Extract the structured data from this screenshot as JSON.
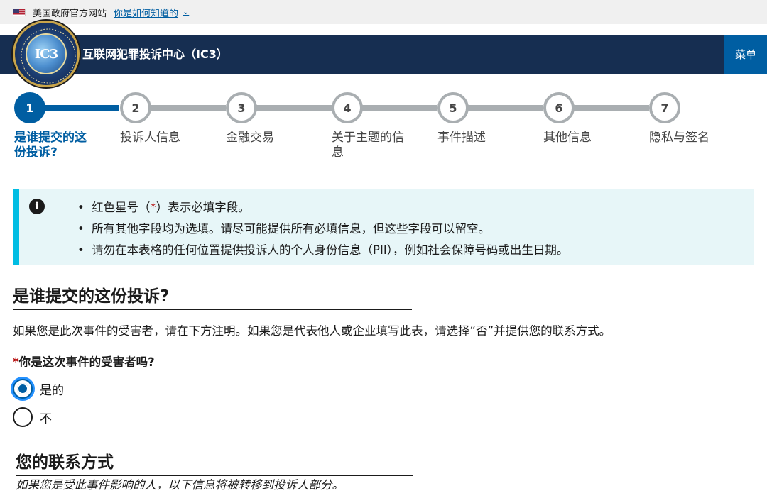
{
  "gov_banner": {
    "text": "美国政府官方网站",
    "link": "你是如何知道的"
  },
  "header": {
    "title": "互联网犯罪投诉中心（IC3）",
    "menu": "菜单",
    "seal_text": "IC3"
  },
  "stepper": {
    "current": 1,
    "steps": [
      {
        "number": "1",
        "label": "是谁提交的这份投诉?"
      },
      {
        "number": "2",
        "label": "投诉人信息"
      },
      {
        "number": "3",
        "label": "金融交易"
      },
      {
        "number": "4",
        "label": "关于主题的信息"
      },
      {
        "number": "5",
        "label": "事件描述"
      },
      {
        "number": "6",
        "label": "其他信息"
      },
      {
        "number": "7",
        "label": "隐私与签名"
      }
    ]
  },
  "alert": {
    "items": [
      {
        "before": "红色星号（",
        "star": "*",
        "after": "）表示必填字段。"
      },
      {
        "text": "所有其他字段均为选填。请尽可能提供所有必填信息，但这些字段可以留空。"
      },
      {
        "text": "请勿在本表格的任何位置提供投诉人的个人身份信息（PII），例如社会保障号码或出生日期。"
      }
    ]
  },
  "form": {
    "section_title": "是谁提交的这份投诉?",
    "description": "如果您是此次事件的受害者，请在下方注明。如果您是代表他人或企业填写此表，请选择“否”并提供您的联系方式。",
    "question_star": "*",
    "question": "你是这次事件的受害者吗?",
    "options": [
      {
        "label": "是的",
        "checked": true
      },
      {
        "label": "不",
        "checked": false
      }
    ],
    "contact_title": "您的联系方式",
    "contact_note": "如果您是受此事件影响的人，以下信息将被转移到投诉人部分。"
  },
  "colors": {
    "primary": "#005ea2",
    "header_bg": "#162e51",
    "info_bg": "#e7f6f8",
    "info_border": "#00bde3",
    "required": "#b50909"
  }
}
